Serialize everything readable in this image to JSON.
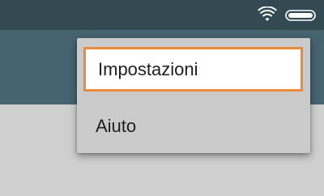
{
  "status_bar": {
    "icons": [
      "wifi-icon",
      "battery-icon"
    ]
  },
  "menu": {
    "items": [
      {
        "label": "Impostazioni",
        "focused": true
      },
      {
        "label": "Aiuto",
        "focused": false
      }
    ]
  },
  "colors": {
    "status_bar": "#334a53",
    "app_bar": "#466370",
    "background": "#cfcfcf",
    "menu_background": "#cbcbcb",
    "focus_border": "#ea8a3a",
    "focus_fill": "#ffffff"
  }
}
